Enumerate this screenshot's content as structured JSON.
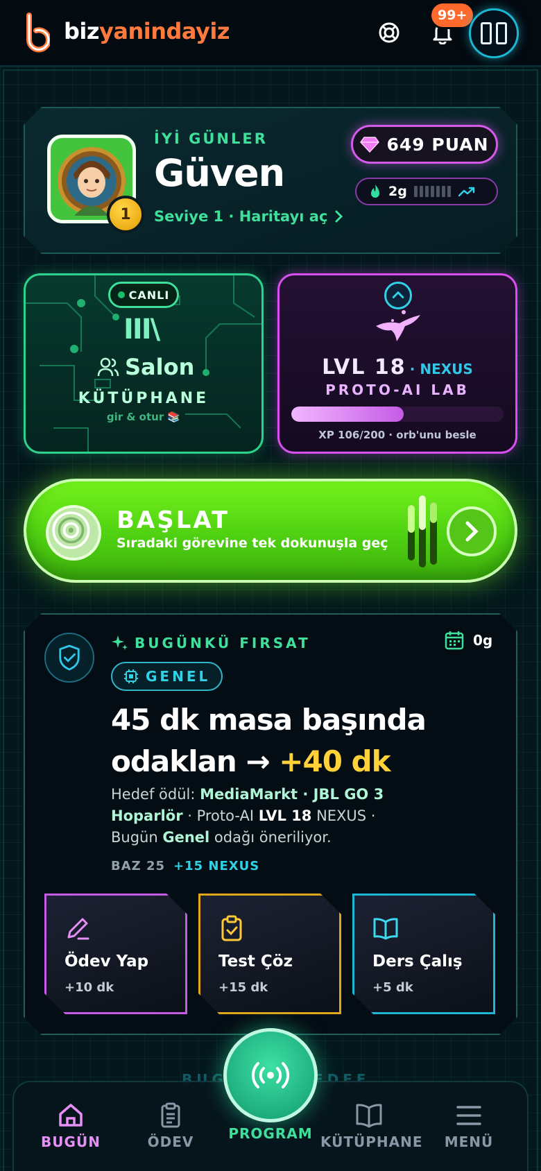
{
  "brand": {
    "part1": "biz",
    "part2": "yanindayiz"
  },
  "header": {
    "notifications_badge": "99+"
  },
  "profile": {
    "greeting": "İYİ GÜNLER",
    "name": "Güven",
    "level_badge": "1",
    "level_link": "Seviye 1 · Haritayı aç",
    "points": "649 PUAN",
    "streak": "2g"
  },
  "salon": {
    "live": "CANLI",
    "glyph": "III\\",
    "title": "Salon",
    "subtitle": "KÜTÜPHANE",
    "hint": "gir & otur 📚"
  },
  "nexus": {
    "level": "LVL 18",
    "name": "· NEXUS",
    "lab": "PROTO-AI LAB",
    "xp_fraction": 0.53,
    "xp_text": "XP 106/200 · orb'unu besle"
  },
  "start": {
    "title": "BAŞLAT",
    "subtitle": "Sıradaki görevine tek dokunuşla geç"
  },
  "opportunity": {
    "tag": "BUGÜNKÜ FIRSAT",
    "days": "0g",
    "category": "GENEL",
    "headline_1": "45 dk masa başında",
    "headline_2": "odaklan → ",
    "headline_bonus": "+40 dk",
    "reward_prefix": "Hedef ödül: ",
    "reward_product": "MediaMarkt · JBL GO 3 Hoparlör",
    "reward_mid": " · Proto-AI ",
    "reward_level": "LVL 18",
    "reward_suffix": " NEXUS · Bugün ",
    "reward_focus": "Genel",
    "reward_end": " odağı öneriliyor.",
    "base": "BAZ 25",
    "bonus": "+15 NEXUS",
    "actions": [
      {
        "title": "Ödev Yap",
        "minutes": "+10 dk"
      },
      {
        "title": "Test Çöz",
        "minutes": "+15 dk"
      },
      {
        "title": "Ders Çalış",
        "minutes": "+5 dk"
      }
    ]
  },
  "faded_section_label": "BUGÜNKÜ HEDEF",
  "nav": {
    "items": [
      "BUGÜN",
      "ÖDEV",
      "PROGRAM",
      "KÜTÜPHANE",
      "MENÜ"
    ],
    "active": "BUGÜN"
  },
  "colors": {
    "accent_green": "#3fe09b",
    "accent_magenta": "#d94ff0",
    "accent_orange": "#ff7a3d",
    "accent_cyan": "#2fd2e6",
    "bonus_yellow": "#ffd23a"
  }
}
